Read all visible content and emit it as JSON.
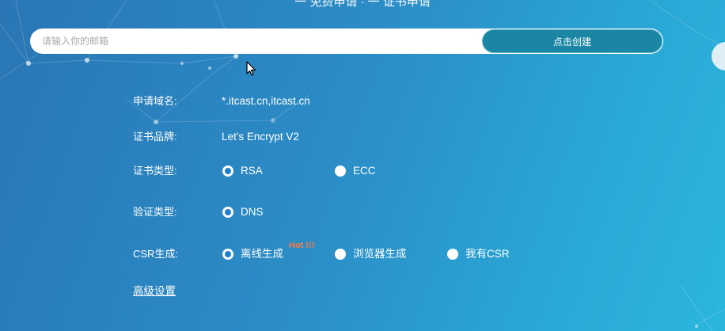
{
  "header": {
    "title": "一 免费申请  ·  一  证书申请"
  },
  "email": {
    "placeholder": "请输入你的邮箱",
    "value": "",
    "create_button": "点击创建"
  },
  "form": {
    "domain": {
      "label": "申请域名:",
      "value": "*.itcast.cn,itcast.cn"
    },
    "brand": {
      "label": "证书品牌:",
      "value": "Let's Encrypt V2"
    },
    "cert_type": {
      "label": "证书类型:",
      "options": [
        {
          "label": "RSA",
          "selected": true
        },
        {
          "label": "ECC",
          "selected": false
        }
      ]
    },
    "verify_type": {
      "label": "验证类型:",
      "options": [
        {
          "label": "DNS",
          "selected": true
        }
      ]
    },
    "csr": {
      "label": "CSR生成:",
      "options": [
        {
          "label": "离线生成",
          "selected": true,
          "badge": "Hot !!!"
        },
        {
          "label": "浏览器生成",
          "selected": false
        },
        {
          "label": "我有CSR",
          "selected": false
        }
      ]
    },
    "advanced_link": "高级设置"
  },
  "colors": {
    "background_start": "#2a76b4",
    "background_end": "#2ab6dc",
    "button": "#1a86a4",
    "radio_selected": "#1f7ed2",
    "hot_badge": "#ff7a45"
  },
  "icons": {
    "cursor": "arrow-cursor-icon",
    "radio_on": "radio-selected-icon",
    "radio_off": "radio-unselected-icon"
  }
}
